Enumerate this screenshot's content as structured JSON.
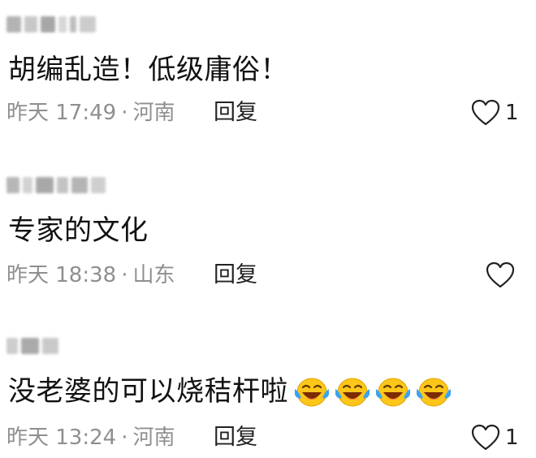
{
  "comments": [
    {
      "username": "",
      "text": "胡编乱造！低级庸俗！",
      "time": "昨天 17:49",
      "location": "河南",
      "reply_label": "回复",
      "likes": "1",
      "emojis": []
    },
    {
      "username": "",
      "text": "专家的文化",
      "time": "昨天 18:38",
      "location": "山东",
      "reply_label": "回复",
      "likes": "",
      "emojis": []
    },
    {
      "username": "",
      "text": "没老婆的可以烧秸杆啦",
      "time": "昨天 13:24",
      "location": "河南",
      "reply_label": "回复",
      "likes": "1",
      "emojis": [
        "laugh-cry-emoji",
        "laugh-cry-emoji",
        "laugh-cry-emoji",
        "laugh-cry-emoji"
      ]
    }
  ],
  "colors": {
    "meta_text": "#8f8f8f",
    "body_text": "#111111",
    "emoji_yellow": "#ffc61a",
    "emoji_tears": "#3aa3f0"
  },
  "separator": "·"
}
